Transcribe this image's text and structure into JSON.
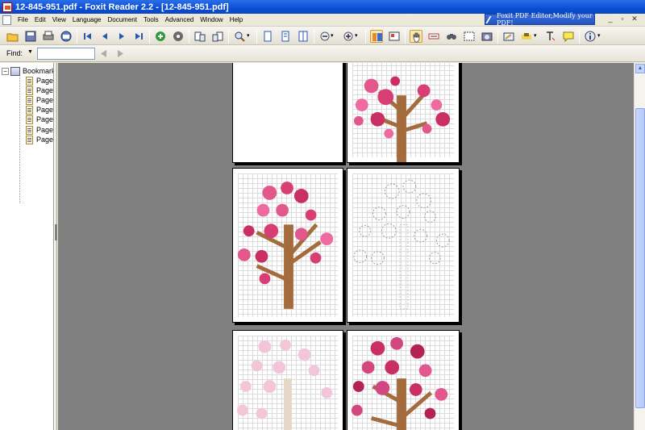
{
  "window": {
    "title": "12-845-951.pdf - Foxit Reader 2.2 - [12-845-951.pdf]"
  },
  "menu": {
    "items": [
      "File",
      "Edit",
      "View",
      "Language",
      "Document",
      "Tools",
      "Advanced",
      "Window",
      "Help"
    ]
  },
  "ad": {
    "text": "Foxit PDF Editor,Modify your PDF!"
  },
  "find": {
    "label": "Find:",
    "value": "",
    "placeholder": ""
  },
  "bookmarks": {
    "root_label": "Bookmarks",
    "items": [
      "Page",
      "Page",
      "Page",
      "Page",
      "Page",
      "Page",
      "Page"
    ]
  },
  "toolbar": {
    "buttons": [
      "open-icon",
      "save-icon",
      "print-icon",
      "email-icon",
      "first-page-icon",
      "prev-page-icon",
      "next-page-icon",
      "last-page-icon",
      "go-back-icon",
      "go-forward-icon",
      "rotate-left-icon",
      "rotate-right-icon",
      "zoom-tool-icon",
      "single-page-icon",
      "continuous-page-icon",
      "facing-pages-icon",
      "zoom-out-icon",
      "zoom-in-icon",
      "thumbnail-view-icon",
      "bookmark-view-icon",
      "hand-tool-icon",
      "select-text-icon",
      "find-icon",
      "snapshot-icon",
      "camera-icon",
      "typewriter-icon",
      "highlight-icon",
      "text-icon",
      "note-icon",
      "info-icon"
    ]
  },
  "colors": {
    "title_blue": "#0b4fd5",
    "viewer_gray": "#808080",
    "tree_pink": "#d2477f",
    "tree_trunk": "#a46b3c"
  }
}
